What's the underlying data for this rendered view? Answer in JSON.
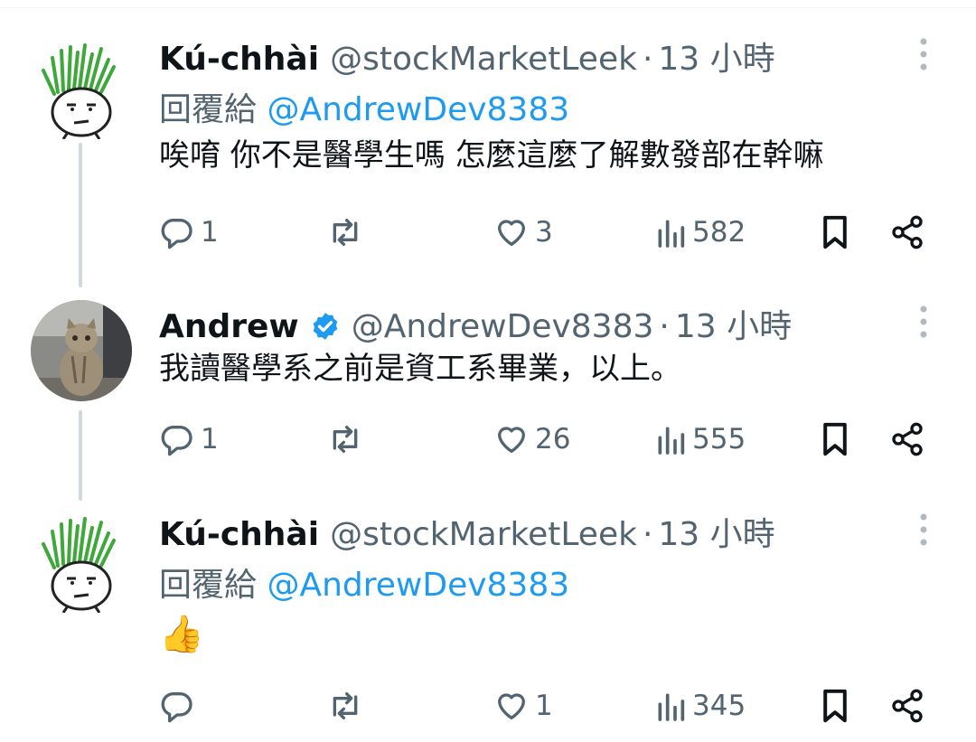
{
  "tweets": [
    {
      "name": "Kú-chhài",
      "handle": "@stockMarketLeek",
      "dot": "·",
      "time": "13 小時",
      "reply_prefix": "回覆給 ",
      "reply_mention": "@AndrewDev8383",
      "text": "唉唷 你不是醫學生嗎 怎麼這麼了解數發部在幹嘛",
      "counts": {
        "replies": "1",
        "retweets": "",
        "likes": "3",
        "views": "582"
      }
    },
    {
      "name": "Andrew",
      "verified": true,
      "handle": "@AndrewDev8383",
      "dot": "·",
      "time": "13 小時",
      "text": "我讀醫學系之前是資工系畢業，以上。",
      "counts": {
        "replies": "1",
        "retweets": "",
        "likes": "26",
        "views": "555"
      }
    },
    {
      "name": "Kú-chhài",
      "handle": "@stockMarketLeek",
      "dot": "·",
      "time": "13 小時",
      "reply_prefix": "回覆給 ",
      "reply_mention": "@AndrewDev8383",
      "text": "👍",
      "counts": {
        "replies": "",
        "retweets": "",
        "likes": "1",
        "views": "345"
      }
    }
  ],
  "colors": {
    "text": "#0f1419",
    "secondary": "#536471",
    "accent": "#1d9bf0",
    "thread_line": "#cfd9de"
  },
  "icons": [
    "reply-icon",
    "retweet-icon",
    "like-icon",
    "views-icon",
    "bookmark-icon",
    "share-icon",
    "more-icon",
    "verified-badge-icon"
  ]
}
